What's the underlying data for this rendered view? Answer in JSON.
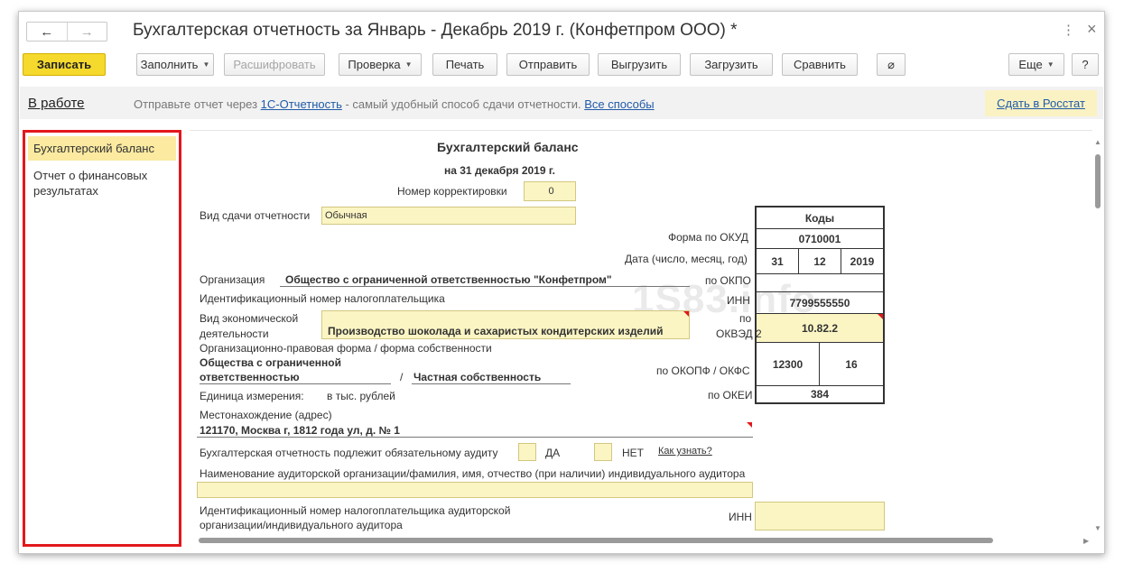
{
  "window": {
    "title": "Бухгалтерская отчетность за Январь - Декабрь 2019 г. (Конфетпром ООО) *",
    "back_icon": "←",
    "forward_icon": "→",
    "more_icon": "⋮",
    "close_icon": "×"
  },
  "toolbar": {
    "save": "Записать",
    "fill": "Заполнить",
    "decode": "Расшифровать",
    "check": "Проверка",
    "print": "Печать",
    "send": "Отправить",
    "export": "Выгрузить",
    "import": "Загрузить",
    "compare": "Сравнить",
    "attach_icon": "⌀",
    "more": "Еще",
    "help": "?",
    "dropdown_icon": "▼"
  },
  "info_strip": {
    "status": "В работе",
    "text_before": "Отправьте отчет через ",
    "link_1c": "1С-Отчетность",
    "text_middle": " - самый удобный способ сдачи отчетности. ",
    "link_all": "Все способы",
    "rosstat": "Сдать в Росстат"
  },
  "sidebar": {
    "items": [
      {
        "label": "Бухгалтерский баланс"
      },
      {
        "label": "Отчет о финансовых результатах"
      }
    ]
  },
  "form": {
    "title": "Бухгалтерский баланс",
    "date": "на 31 декабря 2019 г.",
    "correction_label": "Номер корректировки",
    "correction_value": "0",
    "submission_type_label": "Вид сдачи отчетности",
    "submission_type_value": "Обычная",
    "codes_header": "Коды",
    "okud_label": "Форма по ОКУД",
    "okud_value": "0710001",
    "date_label": "Дата (число, месяц, год)",
    "date_day": "31",
    "date_month": "12",
    "date_year": "2019",
    "org_label": "Организация",
    "org_value": "Общество с ограниченной ответственностью \"Конфетпром\"",
    "okpo_label": "по ОКПО",
    "okpo_value": "",
    "inn_label": "Идентификационный номер налогоплательщика",
    "inn_short": "ИНН",
    "inn_value": "7799555550",
    "activity_label_1": "Вид экономической",
    "activity_label_2": "деятельности",
    "activity_value": "Производство шоколада и сахаристых кондитерских изделий",
    "okved_label_1": "по",
    "okved_label_2": "ОКВЭД 2",
    "okved_value": "10.82.2",
    "legal_form_label": "Организационно-правовая форма / форма собственности",
    "legal_form_value_1": "Общества с ограниченной",
    "legal_form_value_2": "ответственностью",
    "separator": "/",
    "ownership_value": "Частная собственность",
    "okopf_label": "по ОКОПФ / ОКФС",
    "okopf_value": "12300",
    "okfs_value": "16",
    "unit_label": "Единица измерения:",
    "unit_value": "в тыс. рублей",
    "okei_label": "по ОКЕИ",
    "okei_value": "384",
    "address_label": "Местонахождение (адрес)",
    "address_value": "121170, Москва г, 1812 года ул, д. № 1",
    "audit_label": "Бухгалтерская отчетность подлежит обязательному аудиту",
    "audit_yes": "ДА",
    "audit_no": "НЕТ",
    "audit_link": "Как узнать?",
    "auditor_name_label": "Наименование аудиторской организации/фамилия, имя, отчество (при наличии) индивидуального аудитора",
    "auditor_inn_label_1": "Идентификационный номер налогоплательщика аудиторской",
    "auditor_inn_label_2": "организации/индивидуального аудитора",
    "auditor_inn_short": "ИНН",
    "watermark": "1S83.info"
  }
}
